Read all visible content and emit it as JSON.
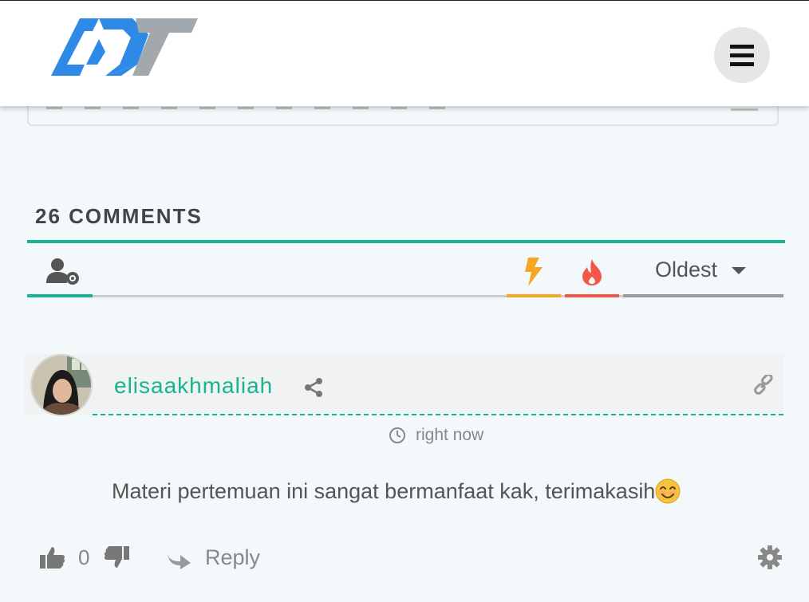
{
  "header": {
    "logo_alt": "ADT",
    "menu_icon": "hamburger-menu-icon",
    "brand_colors": {
      "blue": "#2e8ae6",
      "gray": "#9aa0a6"
    }
  },
  "comments": {
    "count_label": "26 COMMENTS",
    "filters": {
      "user_icon": "user-settings-icon",
      "newest_icon": "lightning-bolt-icon",
      "hot_icon": "fire-icon",
      "sort_label": "Oldest"
    },
    "accent_colors": {
      "green": "#18b394",
      "orange": "#f5a623",
      "red": "#f2574a"
    }
  },
  "comment": {
    "author": "elisaakhmaliah",
    "time": "right now",
    "text": "Materi pertemuan ini sangat bermanfaat kak, terimakasih",
    "emoji": "smiling-face-emoji",
    "votes": "0",
    "reply_label": "Reply"
  }
}
